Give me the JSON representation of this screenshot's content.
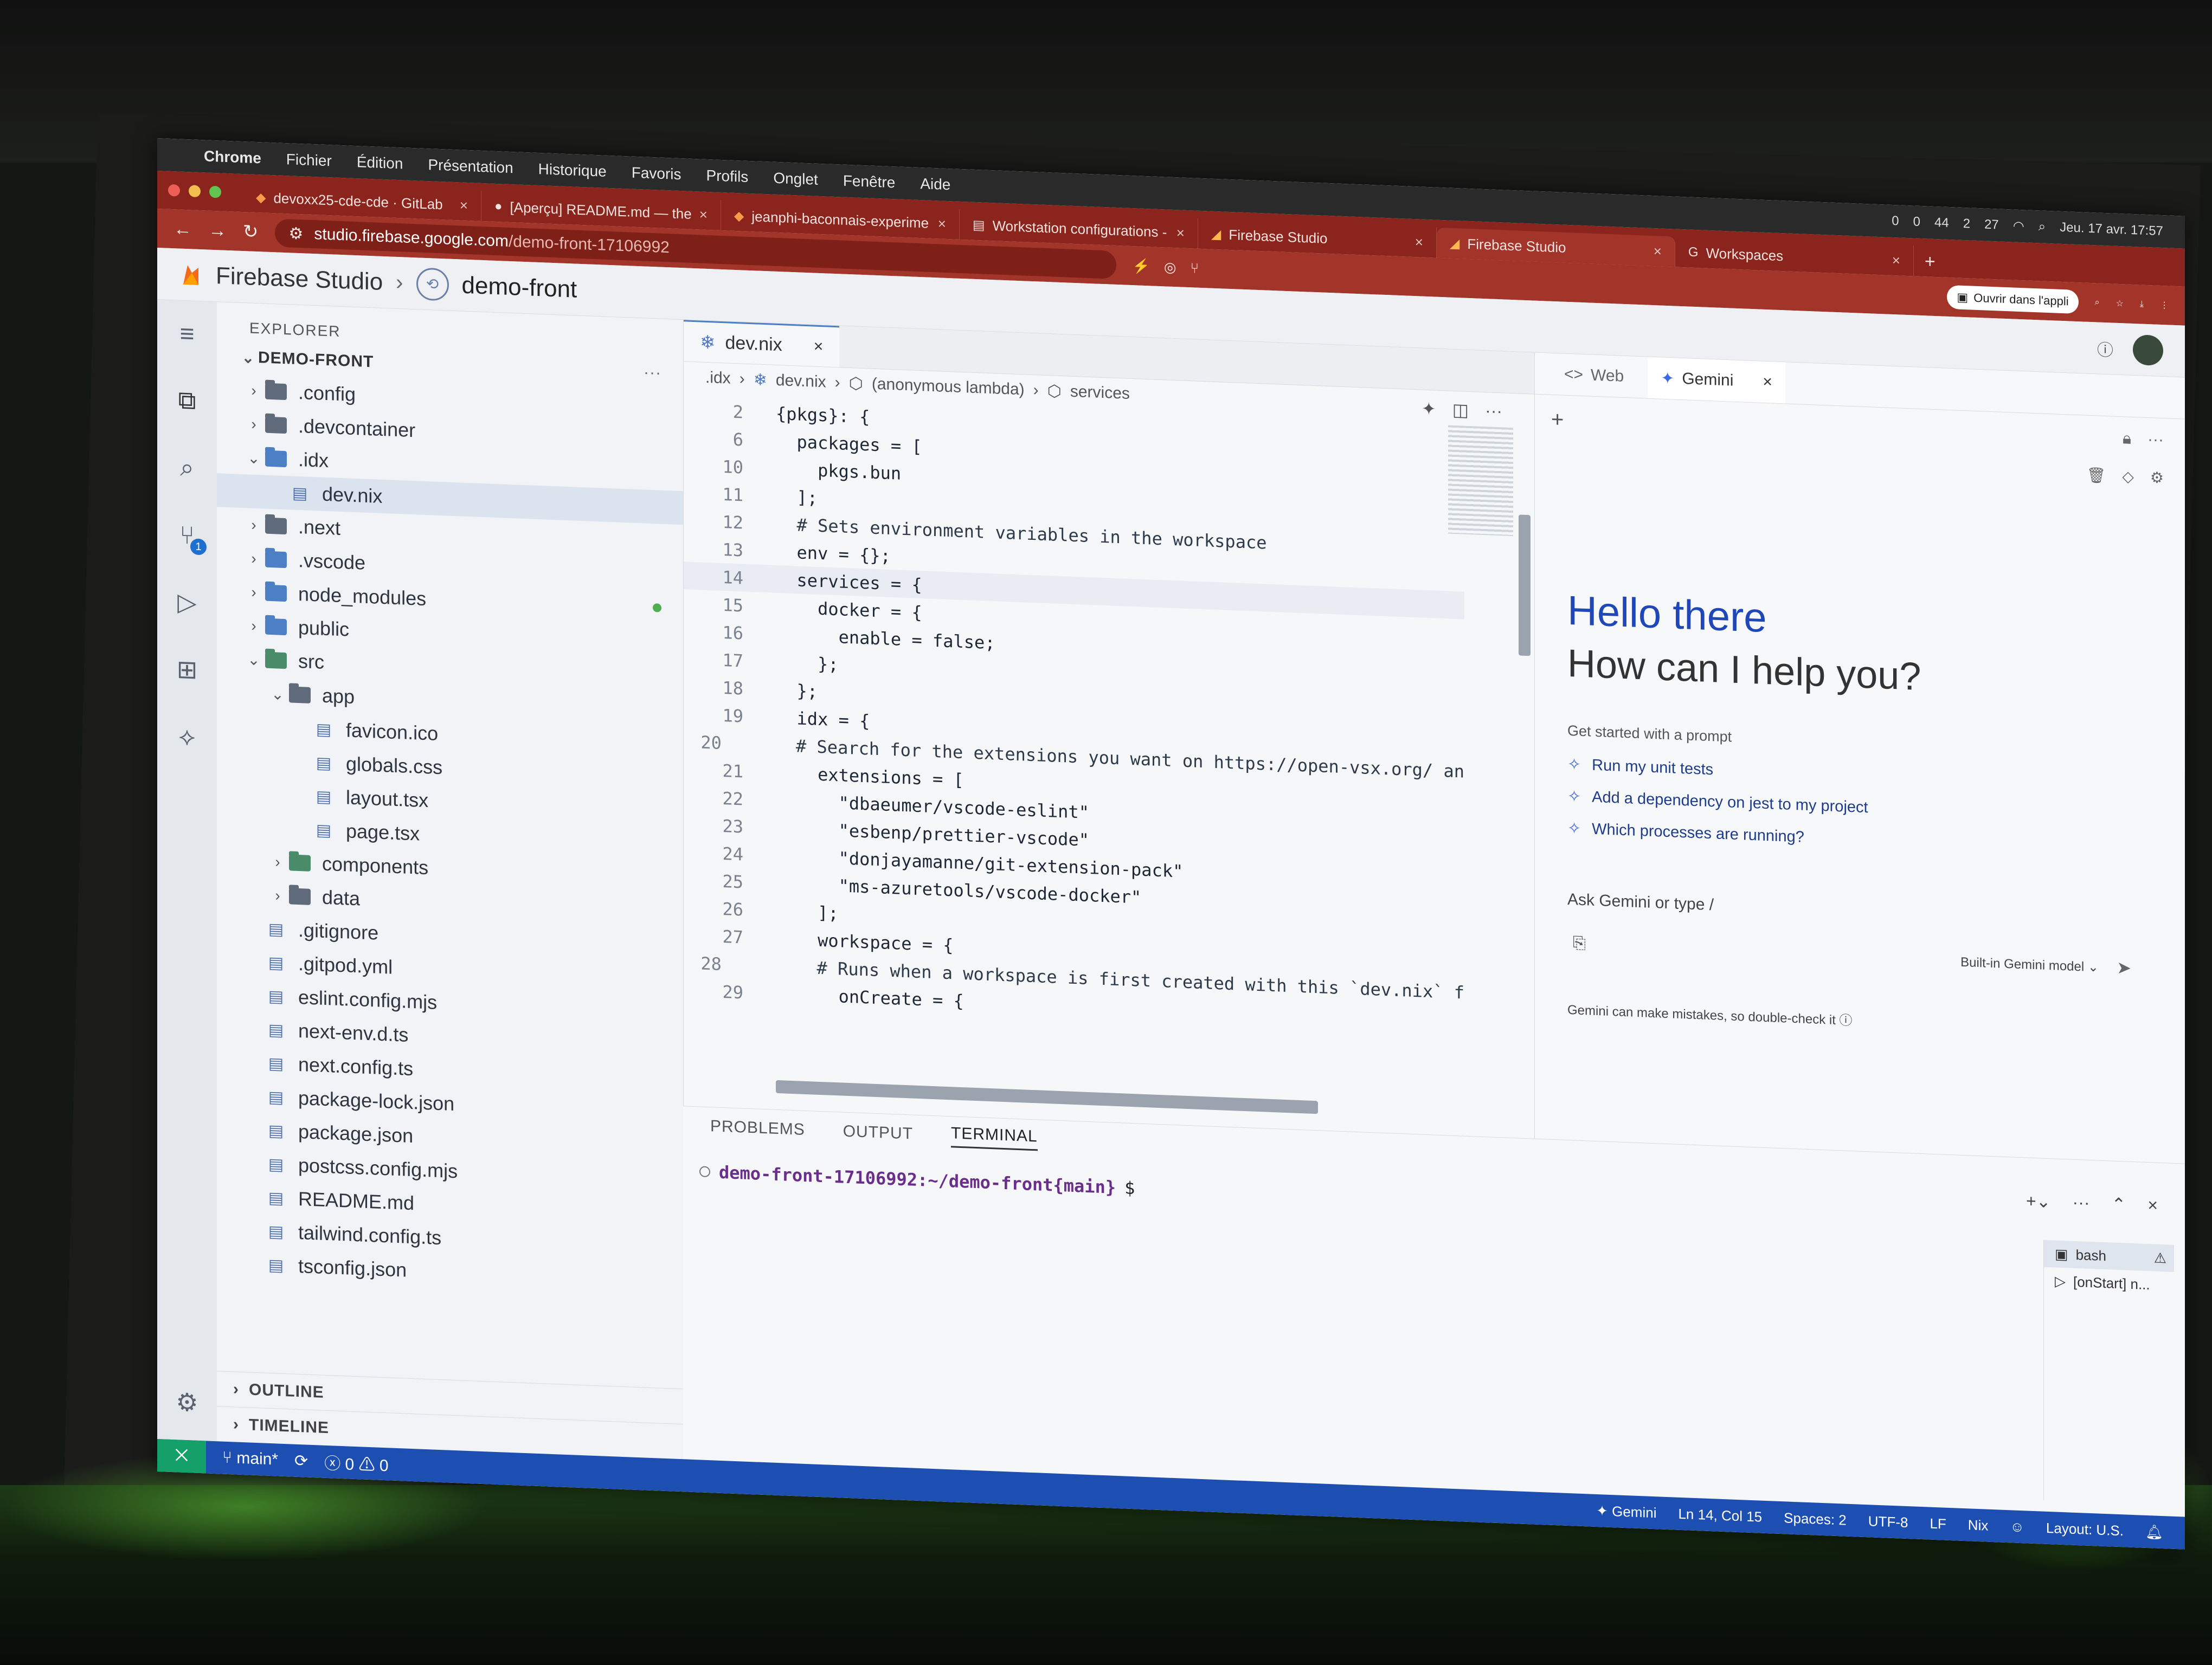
{
  "menubar": {
    "app": "Chrome",
    "items": [
      "Fichier",
      "Édition",
      "Présentation",
      "Historique",
      "Favoris",
      "Profils",
      "Onglet",
      "Fenêtre",
      "Aide"
    ],
    "clock": "Jeu. 17 avr.  17:57",
    "indicators": [
      "0",
      "0",
      "44",
      "2",
      "27"
    ]
  },
  "browser": {
    "tabs": [
      {
        "title": "devoxx25-cde-cde · GitLab",
        "active": false
      },
      {
        "title": "[Aperçu] README.md — the",
        "active": false
      },
      {
        "title": "jeanphi-baconnais-experime",
        "active": false
      },
      {
        "title": "Workstation configurations -",
        "active": false
      },
      {
        "title": "Firebase Studio",
        "active": false
      },
      {
        "title": "Firebase Studio",
        "active": true
      },
      {
        "title": "Workspaces",
        "active": false
      }
    ],
    "url_host": "studio.firebase.google.com",
    "url_path": "/demo-front-17106992",
    "open_in_app": "Ouvrir dans l'appli"
  },
  "header": {
    "title": "Firebase Studio",
    "project": "demo-front"
  },
  "explorer": {
    "title": "EXPLORER",
    "root": "DEMO-FRONT",
    "items": [
      {
        "label": ".config",
        "kind": "folder",
        "depth": 0,
        "open": false
      },
      {
        "label": ".devcontainer",
        "kind": "folder",
        "depth": 0,
        "open": false
      },
      {
        "label": ".idx",
        "kind": "folder-blue",
        "depth": 0,
        "open": true
      },
      {
        "label": "dev.nix",
        "kind": "file",
        "depth": 1,
        "selected": true
      },
      {
        "label": ".next",
        "kind": "folder",
        "depth": 0,
        "open": false
      },
      {
        "label": ".vscode",
        "kind": "folder-blue",
        "depth": 0,
        "open": false
      },
      {
        "label": "node_modules",
        "kind": "folder-blue",
        "depth": 0,
        "open": false,
        "modified": true
      },
      {
        "label": "public",
        "kind": "folder-blue",
        "depth": 0,
        "open": false
      },
      {
        "label": "src",
        "kind": "folder-green",
        "depth": 0,
        "open": true
      },
      {
        "label": "app",
        "kind": "folder",
        "depth": 1,
        "open": true
      },
      {
        "label": "favicon.ico",
        "kind": "file",
        "depth": 2
      },
      {
        "label": "globals.css",
        "kind": "file",
        "depth": 2
      },
      {
        "label": "layout.tsx",
        "kind": "file",
        "depth": 2
      },
      {
        "label": "page.tsx",
        "kind": "file",
        "depth": 2
      },
      {
        "label": "components",
        "kind": "folder-green",
        "depth": 1,
        "open": false
      },
      {
        "label": "data",
        "kind": "folder",
        "depth": 1,
        "open": false
      },
      {
        "label": ".gitignore",
        "kind": "file",
        "depth": 0
      },
      {
        "label": ".gitpod.yml",
        "kind": "file",
        "depth": 0
      },
      {
        "label": "eslint.config.mjs",
        "kind": "file",
        "depth": 0
      },
      {
        "label": "next-env.d.ts",
        "kind": "file",
        "depth": 0
      },
      {
        "label": "next.config.ts",
        "kind": "file",
        "depth": 0
      },
      {
        "label": "package-lock.json",
        "kind": "file",
        "depth": 0
      },
      {
        "label": "package.json",
        "kind": "file",
        "depth": 0
      },
      {
        "label": "postcss.config.mjs",
        "kind": "file",
        "depth": 0
      },
      {
        "label": "README.md",
        "kind": "file",
        "depth": 0
      },
      {
        "label": "tailwind.config.ts",
        "kind": "file",
        "depth": 0
      },
      {
        "label": "tsconfig.json",
        "kind": "file",
        "depth": 0
      }
    ],
    "sections": [
      "OUTLINE",
      "TIMELINE"
    ]
  },
  "activity": {
    "scm_badge": "1"
  },
  "editor": {
    "tab": "dev.nix",
    "breadcrumbs": [
      ".idx",
      "dev.nix",
      "(anonymous lambda)",
      "services"
    ],
    "lines": [
      {
        "n": "2",
        "text": "{pkgs}: {"
      },
      {
        "n": "6",
        "text": "  packages = ["
      },
      {
        "n": "10",
        "text": "    pkgs.bun"
      },
      {
        "n": "11",
        "text": "  ];"
      },
      {
        "n": "12",
        "text": "  # Sets environment variables in the workspace"
      },
      {
        "n": "13",
        "text": "  env = {};"
      },
      {
        "n": "14",
        "text": "  services = {",
        "hl": true
      },
      {
        "n": "15",
        "text": "    docker = {"
      },
      {
        "n": "16",
        "text": "      enable = false;"
      },
      {
        "n": "17",
        "text": "    };"
      },
      {
        "n": "18",
        "text": "  };"
      },
      {
        "n": "19",
        "text": "  idx = {"
      },
      {
        "n": "20",
        "text": "    # Search for the extensions you want on https://open-vsx.org/ an"
      },
      {
        "n": "21",
        "text": "    extensions = ["
      },
      {
        "n": "22",
        "text": "      \"dbaeumer/vscode-eslint\""
      },
      {
        "n": "23",
        "text": "      \"esbenp/prettier-vscode\""
      },
      {
        "n": "24",
        "text": "      \"donjayamanne/git-extension-pack\""
      },
      {
        "n": "25",
        "text": "      \"ms-azuretools/vscode-docker\""
      },
      {
        "n": "26",
        "text": "    ];"
      },
      {
        "n": "27",
        "text": "    workspace = {"
      },
      {
        "n": "28",
        "text": "      # Runs when a workspace is first created with this `dev.nix` f"
      },
      {
        "n": "29",
        "text": "      onCreate = {"
      }
    ]
  },
  "gemini": {
    "tabs": [
      "Web",
      "Gemini"
    ],
    "hello": "Hello there",
    "help": "How can I help you?",
    "started": "Get started with a prompt",
    "prompts": [
      "Run my unit tests",
      "Add a dependency on jest to my project",
      "Which processes are running?"
    ],
    "input_placeholder": "Ask Gemini or type /",
    "model": "Built-in Gemini model",
    "disclaimer": "Gemini can make mistakes, so double-check it"
  },
  "panel": {
    "tabs": [
      "PROBLEMS",
      "OUTPUT",
      "TERMINAL"
    ],
    "active_tab": "TERMINAL",
    "prompt": "demo-front-17106992:~/demo-front{main}",
    "dollar": "$",
    "terminals": [
      "bash",
      "[onStart] n..."
    ]
  },
  "statusbar": {
    "branch": "main*",
    "errors": "0",
    "warnings": "0",
    "gemini": "Gemini",
    "position": "Ln 14, Col 15",
    "spaces": "Spaces: 2",
    "encoding": "UTF-8",
    "eol": "LF",
    "language": "Nix",
    "layout": "Layout: U.S."
  },
  "colors": {
    "chrome_tab": "#8a241c",
    "statusbar": "#1d4fb3",
    "gemini_accent": "#1f47b8"
  }
}
